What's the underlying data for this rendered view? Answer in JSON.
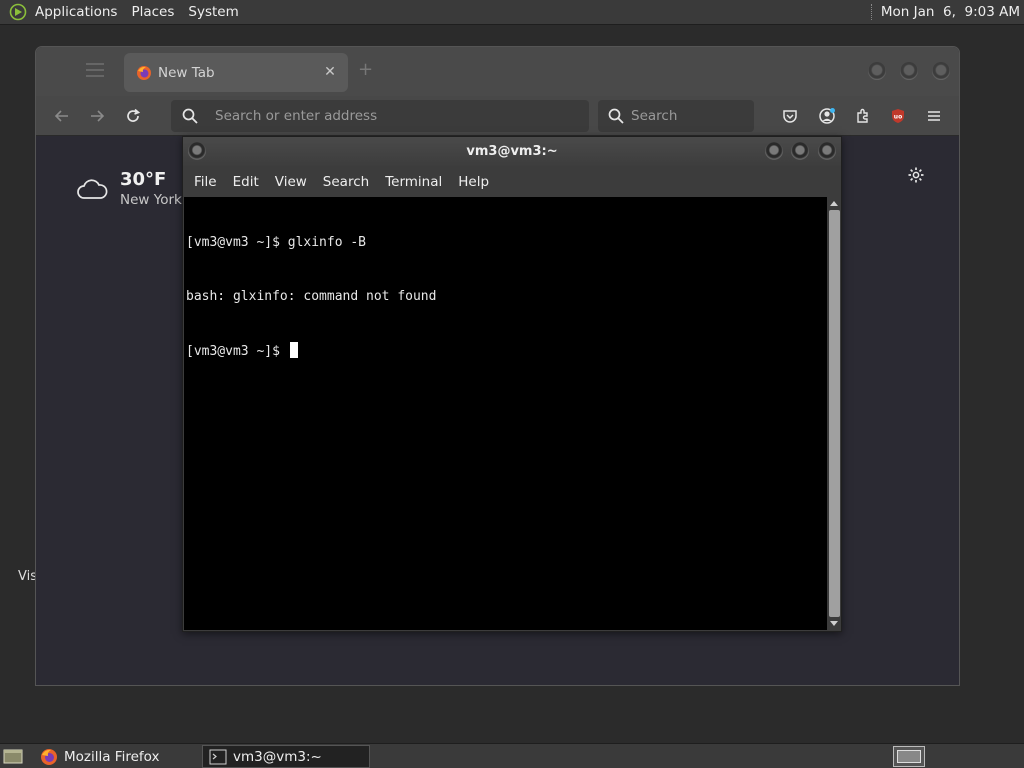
{
  "top_panel": {
    "menus": [
      "Applications",
      "Places",
      "System"
    ],
    "clock": "Mon Jan  6,  9:03 AM"
  },
  "desktop": {
    "partial_label": "Vis"
  },
  "firefox": {
    "tab_title": "New Tab",
    "url_placeholder": "Search or enter address",
    "search_placeholder": "Search",
    "weather": {
      "temperature": "30°F",
      "city": "New York"
    }
  },
  "terminal": {
    "title": "vm3@vm3:~",
    "menus": [
      "File",
      "Edit",
      "View",
      "Search",
      "Terminal",
      "Help"
    ],
    "lines": [
      "[vm3@vm3 ~]$ glxinfo -B",
      "bash: glxinfo: command not found",
      "[vm3@vm3 ~]$ "
    ]
  },
  "taskbar": {
    "tasks": [
      "Mozilla Firefox",
      "vm3@vm3:~"
    ]
  },
  "colors": {
    "panel_bg": "#3a3a3a",
    "terminal_bg": "#000000",
    "firefox_content_bg": "#2b2a33",
    "ublock_red": "#c0392b"
  }
}
